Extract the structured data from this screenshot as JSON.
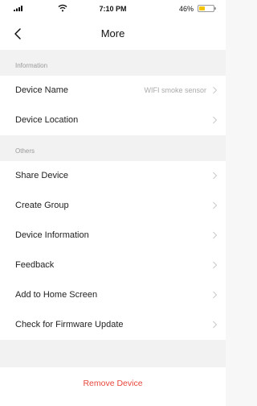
{
  "status_bar": {
    "time": "7:10 PM",
    "battery_text": "46%",
    "battery_level": 0.46,
    "battery_color": "#f5c400"
  },
  "nav": {
    "title": "More",
    "back_icon": "chevron-left-icon"
  },
  "sections": {
    "information": {
      "header": "Information",
      "rows": [
        {
          "label": "Device Name",
          "value": "WIFI smoke sensor"
        },
        {
          "label": "Device Location"
        }
      ]
    },
    "others": {
      "header": "Others",
      "rows": [
        {
          "label": "Share Device"
        },
        {
          "label": "Create Group"
        },
        {
          "label": "Device Information"
        },
        {
          "label": "Feedback"
        },
        {
          "label": "Add to Home Screen"
        },
        {
          "label": "Check for Firmware Update"
        }
      ]
    }
  },
  "remove_button": {
    "label": "Remove Device",
    "color": "#e8463c"
  }
}
